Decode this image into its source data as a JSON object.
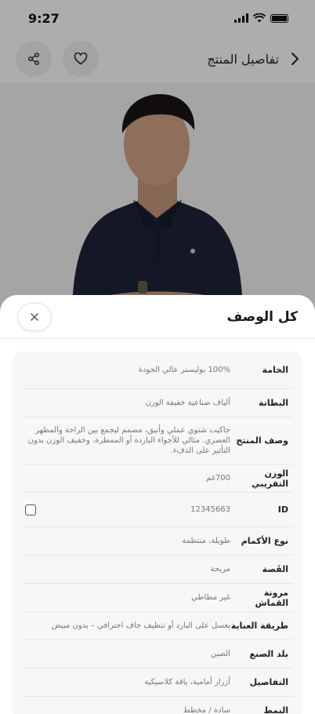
{
  "status_bar": {
    "time": "9:27"
  },
  "nav": {
    "title": "تفاصيل المنتج"
  },
  "sheet": {
    "title": "كل الوصف",
    "rows": [
      {
        "label": "الخامة",
        "value": "100% بوليستر عالي الجودة"
      },
      {
        "label": "البطانة",
        "value": "ألياف صناعية خفيفة الوزن"
      },
      {
        "label": "وصف المنتج",
        "value": "جاكيت شتوي عملي وأنيق، مصمم ليجمع بين الراحة والمظهر العصري. مثالي للأجواء الباردة أو الممطرة، وخفيف الوزن بدون التأثير على الدفء."
      },
      {
        "label": "الوزن التقريبي",
        "value": "700غم"
      },
      {
        "label": "ID",
        "value": "12345663"
      },
      {
        "label": "نوع الأكمام",
        "value": "طويلة، منتظمة"
      },
      {
        "label": "القَصة",
        "value": "مريحة"
      },
      {
        "label": "مرونة القماش",
        "value": "غير مطاطي"
      },
      {
        "label": "طريقة العناية",
        "value": "يغسل على البارد أو تنظيف جاف احترافي – بدون مبيض"
      },
      {
        "label": "بلد الصنع",
        "value": "الصين"
      },
      {
        "label": "التفاصيل",
        "value": "أزرار أمامية، ياقة كلاسيكية"
      },
      {
        "label": "النمط",
        "value": "سادة / مخطط"
      }
    ]
  }
}
